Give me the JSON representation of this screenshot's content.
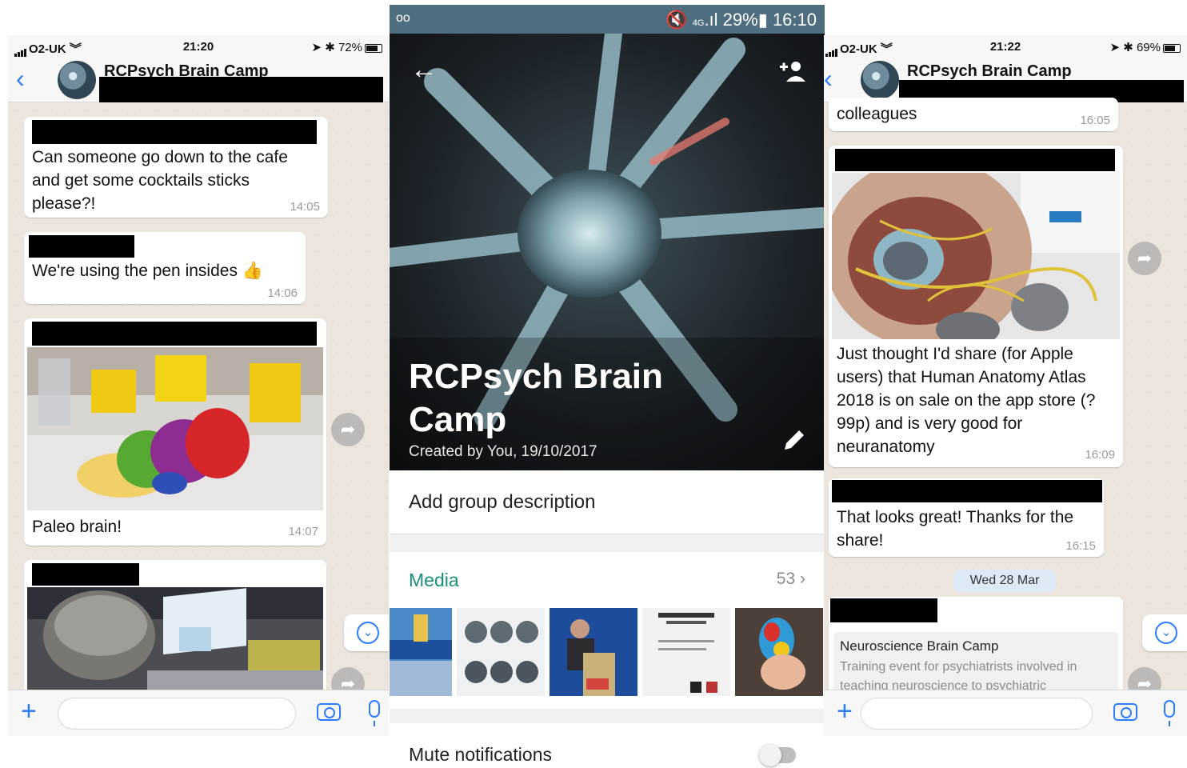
{
  "left": {
    "status": {
      "carrier": "O2-UK",
      "time": "21:20",
      "battery": "72%"
    },
    "group_name": "RCPsych Brain Camp",
    "messages": [
      {
        "text_lines": [
          "Can someone go down to the cafe",
          "and get some cocktails sticks",
          "please?!"
        ],
        "time": "14:05"
      },
      {
        "text": "We're using the pen insides 👍",
        "time": "14:06"
      },
      {
        "caption": "Paleo brain!",
        "time": "14:07"
      }
    ],
    "icons": {
      "back": "chevron-left-icon",
      "forward": "forward-arrow-icon",
      "scroll": "chevron-down-icon",
      "attach": "plus-icon",
      "camera": "camera-icon",
      "mic": "microphone-icon"
    }
  },
  "middle": {
    "status": {
      "time": "16:10",
      "battery": "29%",
      "network": "4G"
    },
    "title_lines": [
      "RCPsych Brain",
      "Camp"
    ],
    "created": "Created by You, 19/10/2017",
    "description_placeholder": "Add group description",
    "media_label": "Media",
    "media_count": "53",
    "mute_label": "Mute notifications",
    "mute_enabled": false,
    "accent_color": "#1a8f7a",
    "icons": {
      "back": "arrow-left-icon",
      "add_participant": "add-person-icon",
      "edit": "pencil-icon"
    }
  },
  "right": {
    "status": {
      "carrier": "O2-UK",
      "time": "21:22",
      "battery": "69%"
    },
    "group_name": "RCPsych Brain Camp",
    "messages": [
      {
        "text": "colleagues",
        "time": "16:05"
      },
      {
        "text_lines": [
          "Just thought I'd share (for Apple",
          "users) that Human Anatomy Atlas",
          "2018 is on sale on the app store (?",
          "99p) and is very good for",
          "neuranatomy"
        ],
        "time": "16:09"
      },
      {
        "text_lines": [
          "That looks great! Thanks for the",
          "share!"
        ],
        "time": "16:15"
      }
    ],
    "date_separator": "Wed 28 Mar",
    "link_preview": {
      "title": "Neuroscience Brain Camp",
      "desc_lines": [
        "Training event for psychiatrists involved in",
        "teaching neuroscience to psychiatric"
      ]
    }
  }
}
